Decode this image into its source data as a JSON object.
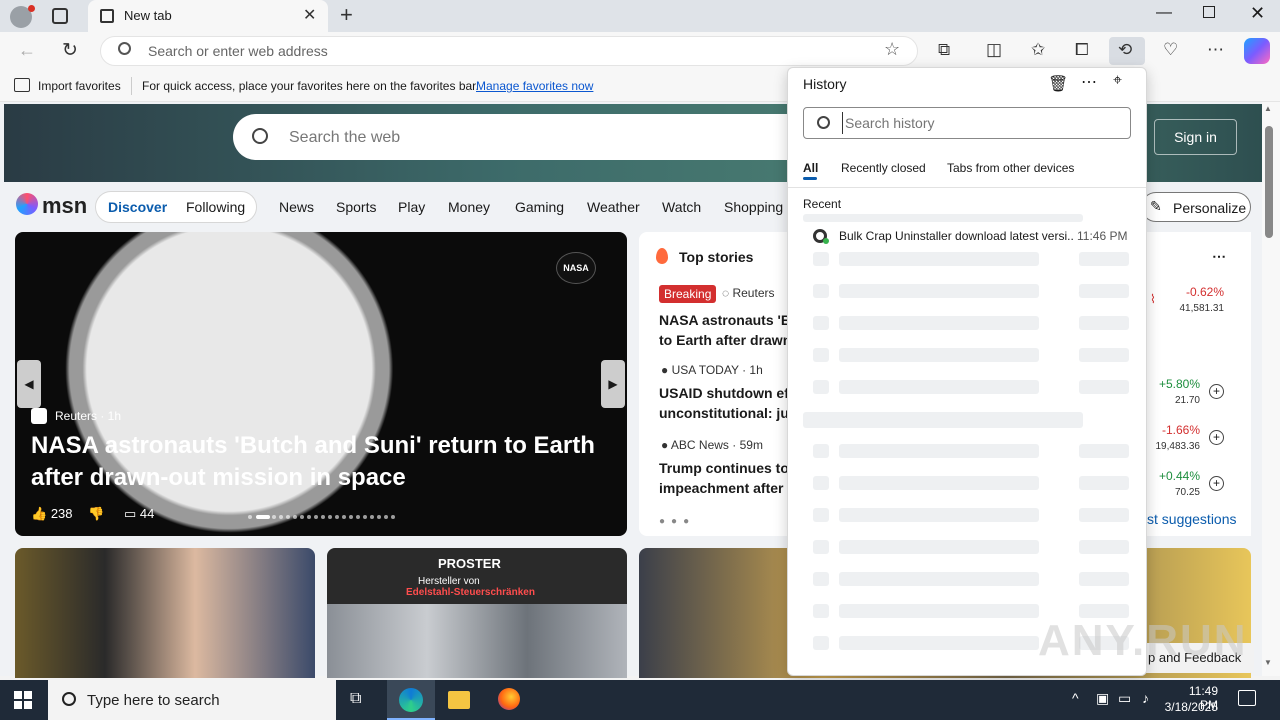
{
  "browser": {
    "tab_title": "New tab",
    "address_placeholder": "Search or enter web address"
  },
  "favorites_bar": {
    "import_label": "Import favorites",
    "hint_text": "For quick access, place your favorites here on the favorites bar.",
    "manage_link": "Manage favorites now"
  },
  "msn": {
    "search_placeholder": "Search the web",
    "signin_label": "Sign in",
    "logo": "msn",
    "nav_primary": [
      "Discover",
      "Following"
    ],
    "nav_items": [
      "News",
      "Sports",
      "Play",
      "Money",
      "Gaming",
      "Weather",
      "Watch",
      "Shopping"
    ],
    "personalize_label": "Personalize",
    "hero": {
      "source": "Reuters · 1h",
      "title": "NASA astronauts 'Butch and Suni' return to Earth after drawn-out mission in space",
      "likes": "238",
      "comments": "44",
      "badge": "NASA"
    },
    "top_stories": {
      "heading": "Top stories",
      "breaking_label": "Breaking",
      "stories": [
        {
          "source": "Reuters",
          "headline_1": "NASA astronauts 'Bu",
          "headline_2": "to Earth after drawn-"
        },
        {
          "source": "USA TODAY · 1h",
          "headline_1": "USAID shutdown eff",
          "headline_2": "unconstitutional: jud"
        },
        {
          "source": "ABC News · 59m",
          "headline_1": "Trump continues to",
          "headline_2": "impeachment after c"
        }
      ]
    },
    "markets": [
      {
        "change": "-0.62%",
        "value": "41,581.31",
        "color": "#d32f2f"
      },
      {
        "change": "+5.80%",
        "value": "21.70",
        "color": "#1e8e3e"
      },
      {
        "change": "-1.66%",
        "value": "19,483.36",
        "color": "#d32f2f"
      },
      {
        "change": "+0.44%",
        "value": "70.25",
        "color": "#1e8e3e"
      }
    ],
    "suggestions_link": "st suggestions",
    "ad": {
      "brand": "PROSTER",
      "line1": "Hersteller von",
      "line2": "Edelstahl-Steuerschränken"
    },
    "feedback_label": "p and Feedback"
  },
  "history_panel": {
    "title": "History",
    "search_placeholder": "Search history",
    "tabs": [
      "All",
      "Recently closed",
      "Tabs from other devices"
    ],
    "section_label": "Recent",
    "items": [
      {
        "title": "Bulk Crap Uninstaller download latest versi...",
        "time": "11:46 PM"
      }
    ]
  },
  "taskbar": {
    "search_placeholder": "Type here to search",
    "time": "11:49 PM",
    "date": "3/18/2025"
  },
  "watermark": "ANY.RUN"
}
